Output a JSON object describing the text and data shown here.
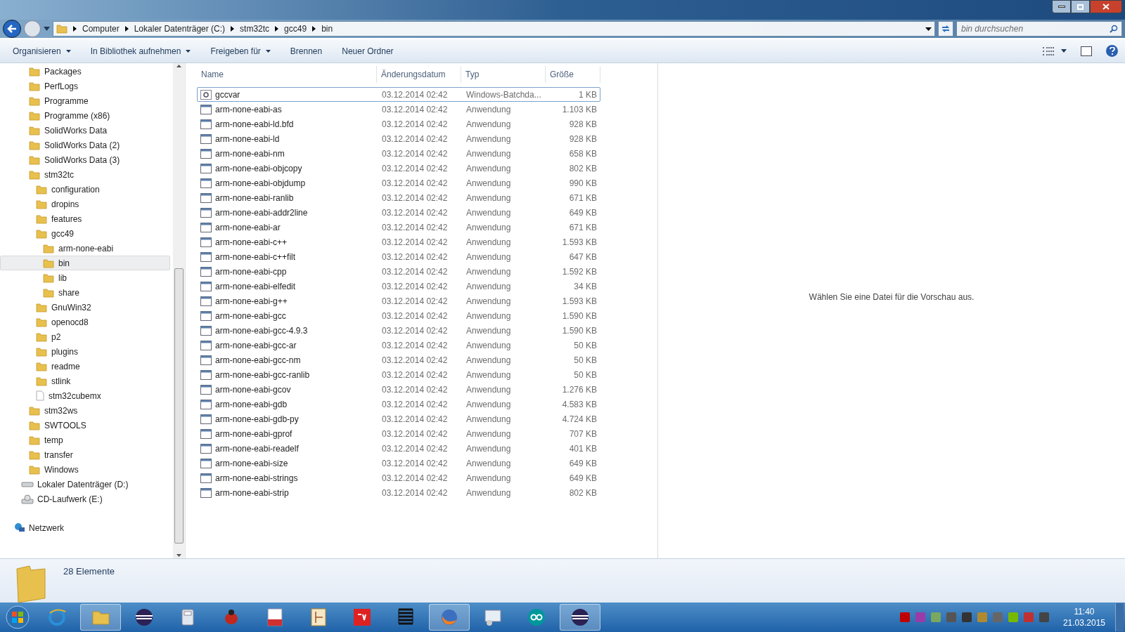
{
  "address_bar": {
    "path": [
      "Computer",
      "Lokaler Datenträger (C:)",
      "stm32tc",
      "gcc49",
      "bin"
    ],
    "search_placeholder": "bin durchsuchen"
  },
  "toolbar": {
    "menus": [
      {
        "label": "Organisieren",
        "dropdown": true
      },
      {
        "label": "In Bibliothek aufnehmen",
        "dropdown": true
      },
      {
        "label": "Freigeben für",
        "dropdown": true
      },
      {
        "label": "Brennen",
        "dropdown": false
      },
      {
        "label": "Neuer Ordner",
        "dropdown": false
      }
    ]
  },
  "sidebar": {
    "items": [
      {
        "label": "Packages",
        "kind": "folder",
        "selected": false
      },
      {
        "label": "PerfLogs",
        "kind": "folder",
        "selected": false
      },
      {
        "label": "Programme",
        "kind": "folder",
        "selected": false
      },
      {
        "label": "Programme (x86)",
        "kind": "folder",
        "selected": false
      },
      {
        "label": "SolidWorks Data",
        "kind": "folder",
        "selected": false
      },
      {
        "label": "SolidWorks Data (2)",
        "kind": "folder",
        "selected": false
      },
      {
        "label": "SolidWorks Data (3)",
        "kind": "folder",
        "selected": false
      },
      {
        "label": "stm32tc",
        "kind": "folder",
        "selected": false,
        "children": [
          {
            "label": "configuration",
            "kind": "folder",
            "selected": false
          },
          {
            "label": "dropins",
            "kind": "folder",
            "selected": false
          },
          {
            "label": "features",
            "kind": "folder",
            "selected": false
          },
          {
            "label": "gcc49",
            "kind": "folder",
            "selected": false,
            "children": [
              {
                "label": "arm-none-eabi",
                "kind": "folder",
                "selected": false
              },
              {
                "label": "bin",
                "kind": "folder",
                "selected": true
              },
              {
                "label": "lib",
                "kind": "folder",
                "selected": false
              },
              {
                "label": "share",
                "kind": "folder",
                "selected": false
              }
            ]
          },
          {
            "label": "GnuWin32",
            "kind": "folder",
            "selected": false
          },
          {
            "label": "openocd8",
            "kind": "folder",
            "selected": false
          },
          {
            "label": "p2",
            "kind": "folder",
            "selected": false
          },
          {
            "label": "plugins",
            "kind": "folder",
            "selected": false
          },
          {
            "label": "readme",
            "kind": "folder",
            "selected": false
          },
          {
            "label": "stlink",
            "kind": "folder",
            "selected": false
          },
          {
            "label": "stm32cubemx",
            "kind": "file",
            "selected": false
          }
        ]
      },
      {
        "label": "stm32ws",
        "kind": "folder",
        "selected": false
      },
      {
        "label": "SWTOOLS",
        "kind": "folder",
        "selected": false
      },
      {
        "label": "temp",
        "kind": "folder",
        "selected": false
      },
      {
        "label": "transfer",
        "kind": "folder",
        "selected": false
      },
      {
        "label": "Windows",
        "kind": "folder",
        "selected": false
      }
    ],
    "drives": [
      {
        "label": "Lokaler Datenträger (D:)",
        "kind": "disk"
      },
      {
        "label": "CD-Laufwerk (E:)",
        "kind": "cd"
      }
    ],
    "network": {
      "label": "Netzwerk"
    }
  },
  "file_list": {
    "columns": [
      "Name",
      "Änderungsdatum",
      "Typ",
      "Größe"
    ],
    "rows": [
      {
        "name": "gccvar",
        "date": "03.12.2014 02:42",
        "type": "Windows-Batchda...",
        "size": "1 KB",
        "kind": "batch",
        "selected": true
      },
      {
        "name": "arm-none-eabi-as",
        "date": "03.12.2014 02:42",
        "type": "Anwendung",
        "size": "1.103 KB",
        "kind": "app",
        "selected": false
      },
      {
        "name": "arm-none-eabi-ld.bfd",
        "date": "03.12.2014 02:42",
        "type": "Anwendung",
        "size": "928 KB",
        "kind": "app",
        "selected": false
      },
      {
        "name": "arm-none-eabi-ld",
        "date": "03.12.2014 02:42",
        "type": "Anwendung",
        "size": "928 KB",
        "kind": "app",
        "selected": false
      },
      {
        "name": "arm-none-eabi-nm",
        "date": "03.12.2014 02:42",
        "type": "Anwendung",
        "size": "658 KB",
        "kind": "app",
        "selected": false
      },
      {
        "name": "arm-none-eabi-objcopy",
        "date": "03.12.2014 02:42",
        "type": "Anwendung",
        "size": "802 KB",
        "kind": "app",
        "selected": false
      },
      {
        "name": "arm-none-eabi-objdump",
        "date": "03.12.2014 02:42",
        "type": "Anwendung",
        "size": "990 KB",
        "kind": "app",
        "selected": false
      },
      {
        "name": "arm-none-eabi-ranlib",
        "date": "03.12.2014 02:42",
        "type": "Anwendung",
        "size": "671 KB",
        "kind": "app",
        "selected": false
      },
      {
        "name": "arm-none-eabi-addr2line",
        "date": "03.12.2014 02:42",
        "type": "Anwendung",
        "size": "649 KB",
        "kind": "app",
        "selected": false
      },
      {
        "name": "arm-none-eabi-ar",
        "date": "03.12.2014 02:42",
        "type": "Anwendung",
        "size": "671 KB",
        "kind": "app",
        "selected": false
      },
      {
        "name": "arm-none-eabi-c++",
        "date": "03.12.2014 02:42",
        "type": "Anwendung",
        "size": "1.593 KB",
        "kind": "app",
        "selected": false
      },
      {
        "name": "arm-none-eabi-c++filt",
        "date": "03.12.2014 02:42",
        "type": "Anwendung",
        "size": "647 KB",
        "kind": "app",
        "selected": false
      },
      {
        "name": "arm-none-eabi-cpp",
        "date": "03.12.2014 02:42",
        "type": "Anwendung",
        "size": "1.592 KB",
        "kind": "app",
        "selected": false
      },
      {
        "name": "arm-none-eabi-elfedit",
        "date": "03.12.2014 02:42",
        "type": "Anwendung",
        "size": "34 KB",
        "kind": "app",
        "selected": false
      },
      {
        "name": "arm-none-eabi-g++",
        "date": "03.12.2014 02:42",
        "type": "Anwendung",
        "size": "1.593 KB",
        "kind": "app",
        "selected": false
      },
      {
        "name": "arm-none-eabi-gcc",
        "date": "03.12.2014 02:42",
        "type": "Anwendung",
        "size": "1.590 KB",
        "kind": "app",
        "selected": false
      },
      {
        "name": "arm-none-eabi-gcc-4.9.3",
        "date": "03.12.2014 02:42",
        "type": "Anwendung",
        "size": "1.590 KB",
        "kind": "app",
        "selected": false
      },
      {
        "name": "arm-none-eabi-gcc-ar",
        "date": "03.12.2014 02:42",
        "type": "Anwendung",
        "size": "50 KB",
        "kind": "app",
        "selected": false
      },
      {
        "name": "arm-none-eabi-gcc-nm",
        "date": "03.12.2014 02:42",
        "type": "Anwendung",
        "size": "50 KB",
        "kind": "app",
        "selected": false
      },
      {
        "name": "arm-none-eabi-gcc-ranlib",
        "date": "03.12.2014 02:42",
        "type": "Anwendung",
        "size": "50 KB",
        "kind": "app",
        "selected": false
      },
      {
        "name": "arm-none-eabi-gcov",
        "date": "03.12.2014 02:42",
        "type": "Anwendung",
        "size": "1.276 KB",
        "kind": "app",
        "selected": false
      },
      {
        "name": "arm-none-eabi-gdb",
        "date": "03.12.2014 02:42",
        "type": "Anwendung",
        "size": "4.583 KB",
        "kind": "app",
        "selected": false
      },
      {
        "name": "arm-none-eabi-gdb-py",
        "date": "03.12.2014 02:42",
        "type": "Anwendung",
        "size": "4.724 KB",
        "kind": "app",
        "selected": false
      },
      {
        "name": "arm-none-eabi-gprof",
        "date": "03.12.2014 02:42",
        "type": "Anwendung",
        "size": "707 KB",
        "kind": "app",
        "selected": false
      },
      {
        "name": "arm-none-eabi-readelf",
        "date": "03.12.2014 02:42",
        "type": "Anwendung",
        "size": "401 KB",
        "kind": "app",
        "selected": false
      },
      {
        "name": "arm-none-eabi-size",
        "date": "03.12.2014 02:42",
        "type": "Anwendung",
        "size": "649 KB",
        "kind": "app",
        "selected": false
      },
      {
        "name": "arm-none-eabi-strings",
        "date": "03.12.2014 02:42",
        "type": "Anwendung",
        "size": "649 KB",
        "kind": "app",
        "selected": false
      },
      {
        "name": "arm-none-eabi-strip",
        "date": "03.12.2014 02:42",
        "type": "Anwendung",
        "size": "802 KB",
        "kind": "app",
        "selected": false
      }
    ]
  },
  "preview": {
    "message": "Wählen Sie eine Datei für die Vorschau aus."
  },
  "status_bar": {
    "count": "28 Elemente"
  },
  "taskbar": {
    "apps": [
      {
        "kind": "ie",
        "running": false
      },
      {
        "kind": "explorer",
        "running": true
      },
      {
        "kind": "eclipse",
        "running": false
      },
      {
        "kind": "calculator",
        "running": false
      },
      {
        "kind": "bug",
        "running": false
      },
      {
        "kind": "pdf",
        "running": false
      },
      {
        "kind": "schematic",
        "running": false
      },
      {
        "kind": "solidworks",
        "running": false
      },
      {
        "kind": "spring",
        "running": false
      },
      {
        "kind": "firefox",
        "running": true
      },
      {
        "kind": "monitor",
        "running": false
      },
      {
        "kind": "arduino",
        "running": false
      },
      {
        "kind": "eclipse",
        "running": true
      }
    ],
    "tray": [
      {
        "color": "#c00000"
      },
      {
        "color": "#9b3aa8"
      },
      {
        "color": "#7aa860"
      },
      {
        "color": "#555555"
      },
      {
        "color": "#333333"
      },
      {
        "color": "#b08a30"
      },
      {
        "color": "#666666"
      },
      {
        "color": "#76b900"
      },
      {
        "color": "#c03030"
      },
      {
        "color": "#444444"
      }
    ],
    "time": "11:40",
    "date": "21.03.2015"
  }
}
